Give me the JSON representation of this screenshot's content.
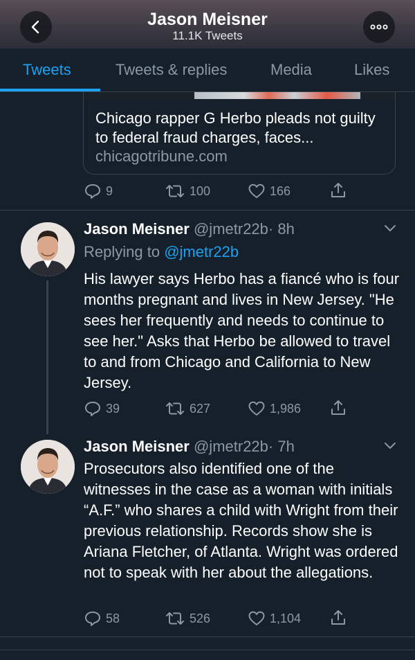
{
  "header": {
    "title": "Jason Meisner",
    "subtitle": "11.1K Tweets",
    "back_icon": "chevron-left-icon",
    "more_icon": "more-horizontal-icon"
  },
  "tabs": [
    {
      "label": "Tweets",
      "active": true
    },
    {
      "label": "Tweets & replies",
      "active": false
    },
    {
      "label": "Media",
      "active": false
    },
    {
      "label": "Likes",
      "active": false
    }
  ],
  "link_card": {
    "title": "Chicago rapper G Herbo pleads not guilty to federal fraud charges, faces...",
    "domain": "chicagotribune.com"
  },
  "tweet0_actions": {
    "replies": "9",
    "retweets": "100",
    "likes": "166"
  },
  "tweet1": {
    "name": "Jason Meisner",
    "handle": "@jmetr22b",
    "time": "· 8h",
    "replying_prefix": "Replying to",
    "replying_handle": "@jmetr22b",
    "text": "His lawyer says Herbo has a fiancé who is four months pregnant and lives in New Jersey. \"He sees her frequently and needs to continue to see her.\" Asks that Herbo be allowed to travel to and from Chicago and California to New Jersey.",
    "replies": "39",
    "retweets": "627",
    "likes": "1,986"
  },
  "tweet2": {
    "name": "Jason Meisner",
    "handle": "@jmetr22b",
    "time": "· 7h",
    "text": "Prosecutors also identified one of the witnesses in the case as a woman with initials “A.F.” who shares a child with Wright from their previous relationship. Records show she is Ariana Fletcher, of Atlanta. Wright was ordered not to speak with her about the allegations.",
    "replies": "58",
    "retweets": "526",
    "likes": "1,104"
  },
  "colors": {
    "background": "#15202b",
    "accent": "#1da1f2",
    "secondary_text": "#8b98a5",
    "divider": "#38444d"
  }
}
